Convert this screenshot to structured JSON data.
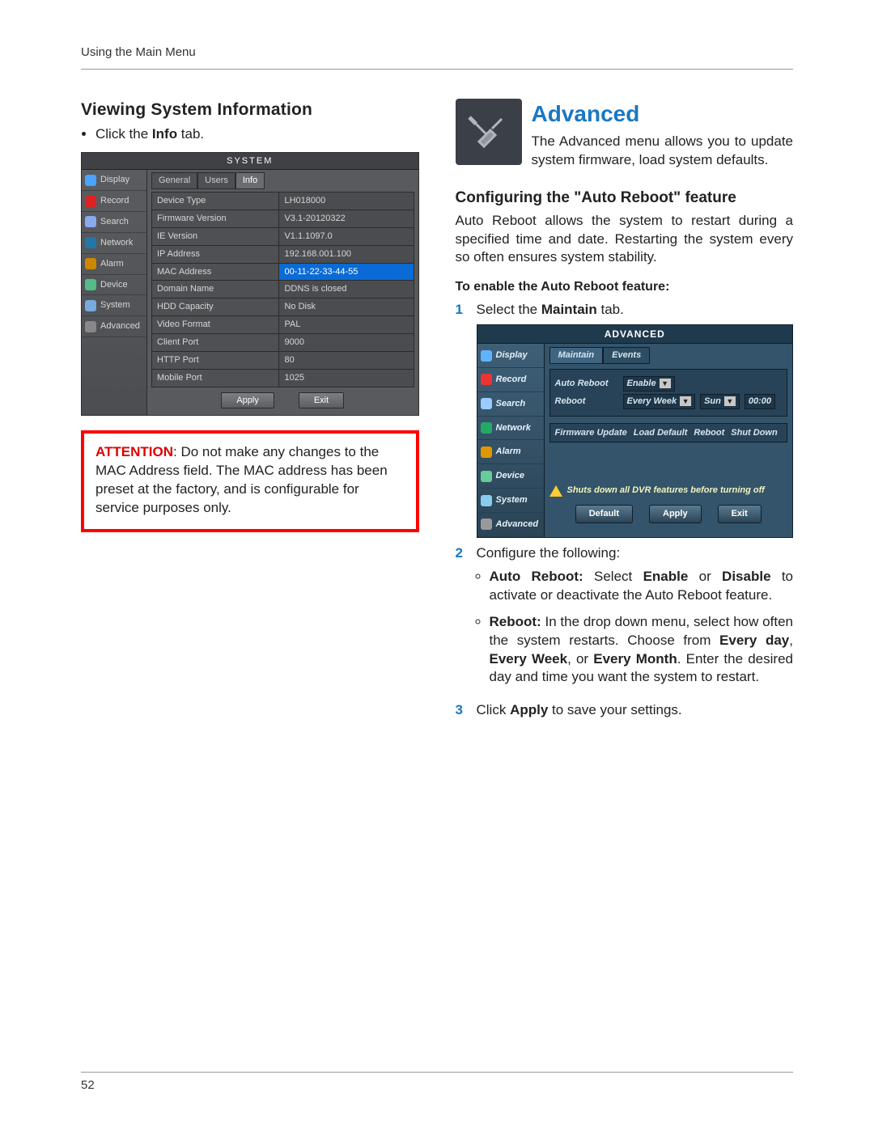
{
  "running_head": "Using the Main Menu",
  "page_number": "52",
  "left": {
    "heading": "Viewing System Information",
    "click_info_pre": "Click the ",
    "click_info_bold": "Info",
    "click_info_post": " tab.",
    "attention_label": "ATTENTION",
    "attention_text": ": Do not make any changes to the MAC Address field. The MAC address has been preset at the factory, and is configurable for service purposes only."
  },
  "shot1": {
    "title": "SYSTEM",
    "side": [
      "Display",
      "Record",
      "Search",
      "Network",
      "Alarm",
      "Device",
      "System",
      "Advanced"
    ],
    "tabs": [
      "General",
      "Users",
      "Info"
    ],
    "active_tab": "Info",
    "rows": [
      {
        "k": "Device Type",
        "v": "LH018000"
      },
      {
        "k": "Firmware Version",
        "v": "V3.1-20120322"
      },
      {
        "k": "IE Version",
        "v": "V1.1.1097.0"
      },
      {
        "k": "IP Address",
        "v": "192.168.001.100"
      },
      {
        "k": "MAC Address",
        "v": "00-11-22-33-44-55",
        "hl": true
      },
      {
        "k": "Domain Name",
        "v": "DDNS is closed"
      },
      {
        "k": "HDD Capacity",
        "v": "No Disk"
      },
      {
        "k": "Video Format",
        "v": "PAL"
      },
      {
        "k": "Client Port",
        "v": "9000"
      },
      {
        "k": "HTTP Port",
        "v": "80"
      },
      {
        "k": "Mobile Port",
        "v": "1025"
      }
    ],
    "apply": "Apply",
    "exit": "Exit"
  },
  "right": {
    "heading": "Advanced",
    "intro": "The Advanced menu allows you to update system firmware, load system defaults.",
    "sub": "Configuring the \"Auto Reboot\" feature",
    "sub_text": "Auto Reboot allows the system to restart during a specified time and date. Restarting the system every so often ensures system stability.",
    "steps_heading": "To enable the Auto Reboot feature:",
    "step1_pre": "Select the ",
    "step1_bold": "Maintain",
    "step1_post": " tab.",
    "step2": "Configure the following:",
    "step2a_b1": "Auto Reboot:",
    "step2a_t1": " Select ",
    "step2a_b2": "Enable",
    "step2a_t2": " or ",
    "step2a_b3": "Disable",
    "step2a_t3": " to activate or deactivate the Auto Reboot feature.",
    "step2b_b1": "Reboot:",
    "step2b_t1": " In the drop down menu, select how often the system restarts. Choose from ",
    "step2b_b2": "Every day",
    "step2b_t2": ", ",
    "step2b_b3": "Every Week",
    "step2b_t3": ", or ",
    "step2b_b4": "Every Month",
    "step2b_t4": ". Enter the desired day and time you want the system to restart.",
    "step3_pre": "Click ",
    "step3_bold": "Apply",
    "step3_post": " to save your settings."
  },
  "shot2": {
    "title": "ADVANCED",
    "side": [
      "Display",
      "Record",
      "Search",
      "Network",
      "Alarm",
      "Device",
      "System",
      "Advanced"
    ],
    "tabs": [
      "Maintain",
      "Events"
    ],
    "active_tab": "Maintain",
    "row1_label": "Auto Reboot",
    "row1_value": "Enable",
    "row2_label": "Reboot",
    "row2_v1": "Every Week",
    "row2_v2": "Sun",
    "row2_v3": "00:00",
    "panel2": [
      "Firmware Update",
      "Load Default",
      "Reboot",
      "Shut Down"
    ],
    "note": "Shuts down all DVR features before turning off",
    "btns": [
      "Default",
      "Apply",
      "Exit"
    ]
  }
}
